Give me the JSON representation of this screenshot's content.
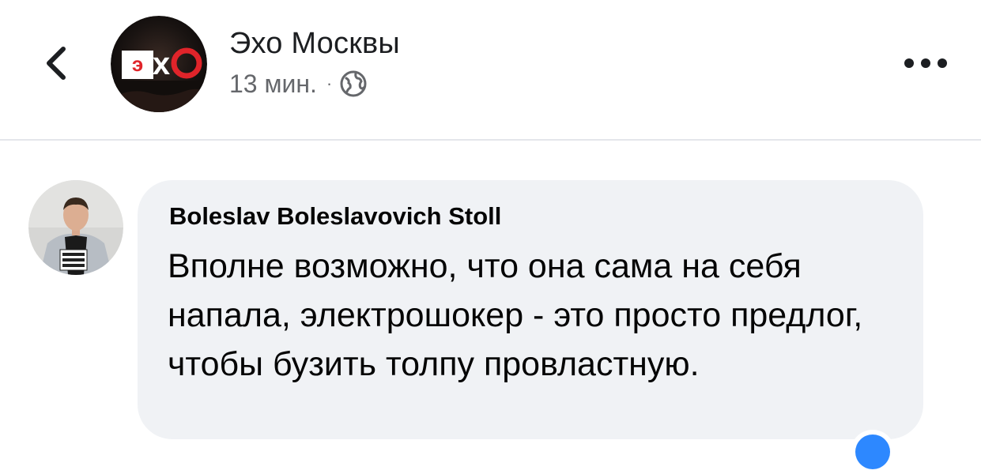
{
  "header": {
    "page_name": "Эхо Москвы",
    "timestamp": "13 мин.",
    "separator": "·",
    "privacy_icon": "globe-icon",
    "back_icon": "chevron-left-icon",
    "more_icon": "more-dots-icon",
    "logo_text": "эхо"
  },
  "comment": {
    "author": "Boleslav Boleslavovich Stoll",
    "text": "Вполне возможно, что она сама на себя напала, электрошокер - это просто предлог, чтобы бузить толпу провластную.",
    "avatar_badge_text": "СВОБОДУ ВСЕМ НЕМЕДЛЕННО",
    "reaction_icon": "like-reaction-icon"
  },
  "colors": {
    "bubble_bg": "#f0f2f5",
    "text_primary": "#1c1e21",
    "text_secondary": "#65676b",
    "reaction_blue": "#2d88ff",
    "logo_red": "#e0242a"
  }
}
